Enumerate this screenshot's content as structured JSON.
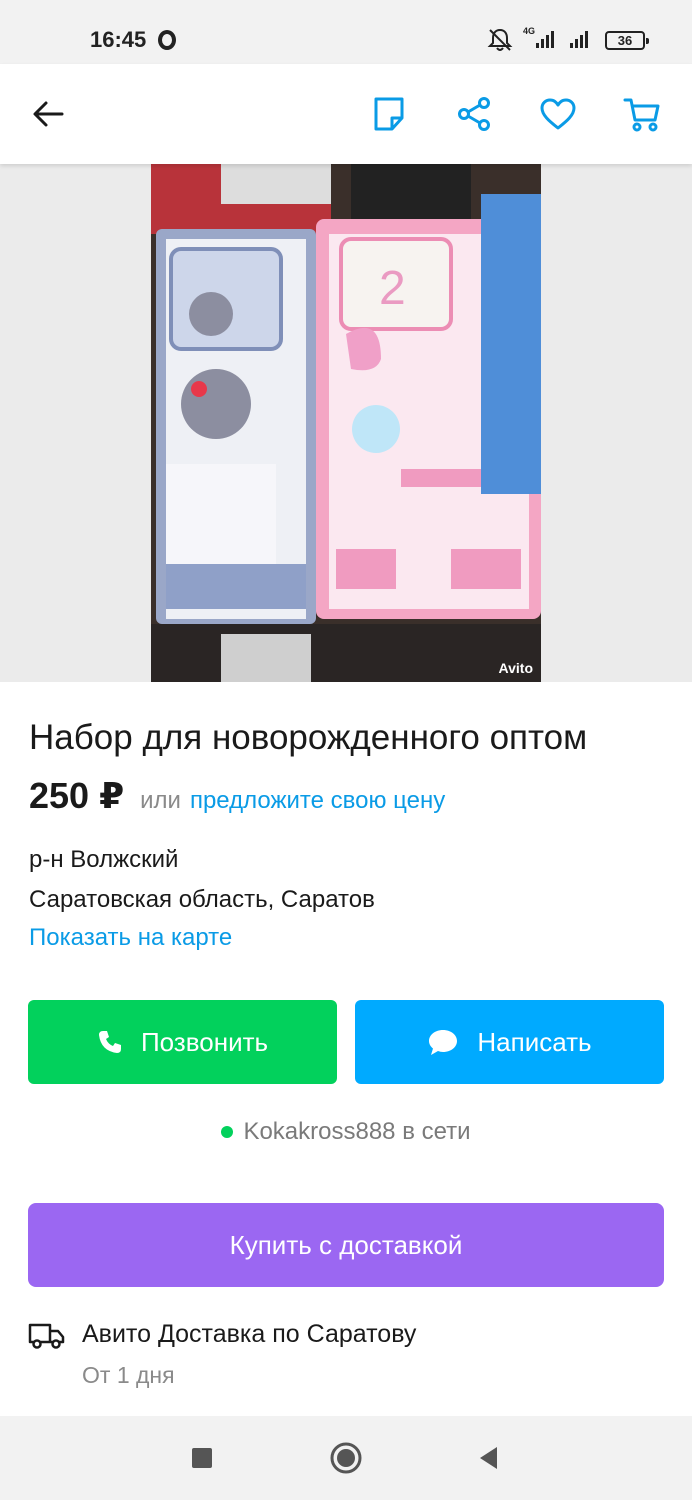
{
  "status_bar": {
    "time": "16:45",
    "network": "4G",
    "battery": "36"
  },
  "toolbar": {
    "icons": [
      "back-arrow-icon",
      "note-icon",
      "share-icon",
      "heart-icon",
      "cart-icon"
    ],
    "accent_color": "#0a9be6"
  },
  "listing": {
    "photo_watermark": "Avito",
    "title": "Набор для новорожденного оптом",
    "price": "250 ₽",
    "price_or": "или",
    "price_offer": "предложите свою цену",
    "district": "р-н Волжский",
    "region": "Саратовская область, Саратов",
    "map_link": "Показать на карте"
  },
  "actions": {
    "call_label": "Позвонить",
    "write_label": "Написать",
    "call_color": "#02d15c",
    "write_color": "#00aaff"
  },
  "seller": {
    "status_text": "Kokakross888 в сети"
  },
  "buy": {
    "label": "Купить с доставкой",
    "color": "#9b67f2"
  },
  "delivery": {
    "title": "Авито Доставка по Саратову",
    "subtitle": "От 1 дня"
  },
  "nav": {
    "buttons": [
      "recent-apps-icon",
      "home-icon",
      "back-icon"
    ]
  }
}
